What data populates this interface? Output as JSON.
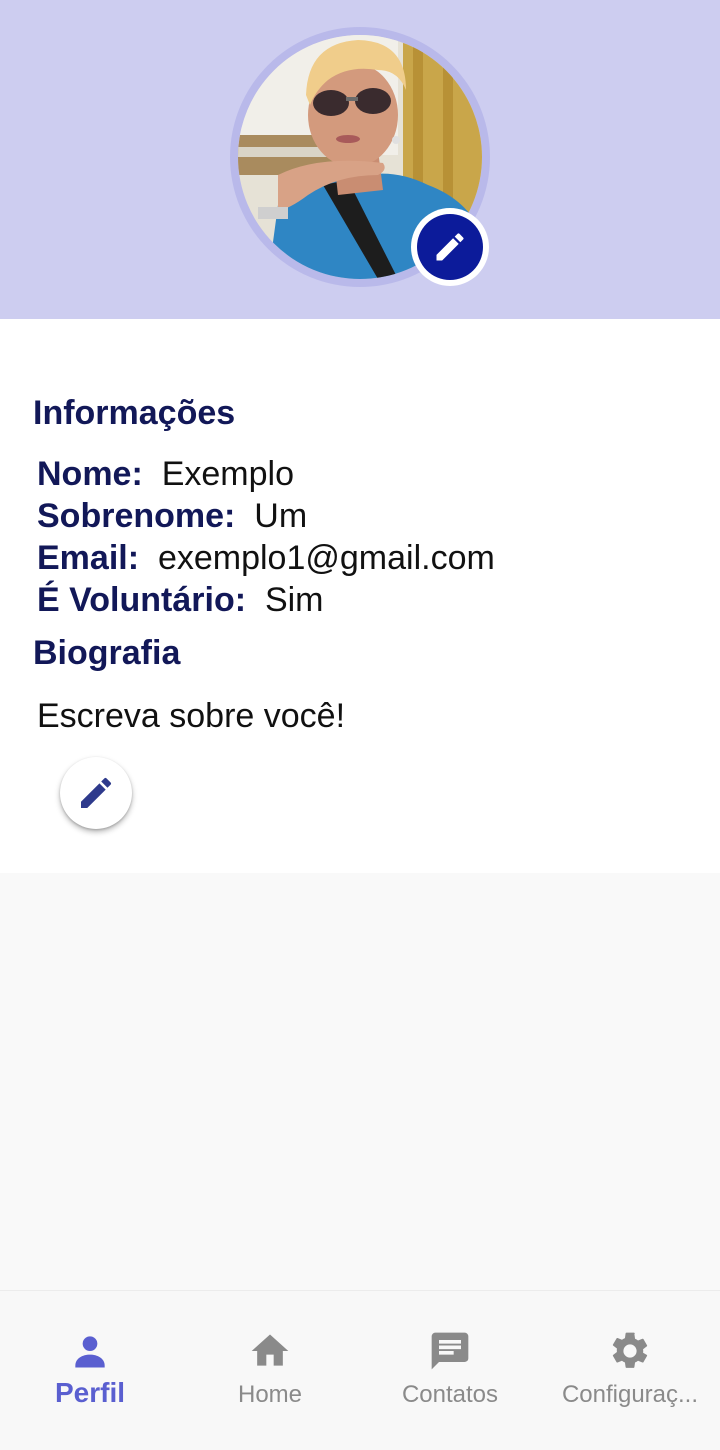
{
  "header": {
    "avatar_alt": "Foto de perfil",
    "colors": {
      "background": "#cdcdf0",
      "edit_button": "#0c1b9a"
    },
    "edit_icon": "pencil-icon"
  },
  "info": {
    "title": "Informações",
    "fields": [
      {
        "label": "Nome:",
        "value": "Exemplo"
      },
      {
        "label": "Sobrenome:",
        "value": "Um"
      },
      {
        "label": "Email:",
        "value": "exemplo1@gmail.com"
      },
      {
        "label": "É Voluntário:",
        "value": "Sim"
      }
    ]
  },
  "bio": {
    "title": "Biografia",
    "text": "Escreva sobre você!",
    "edit_icon": "pencil-icon"
  },
  "bottom_nav": {
    "items": [
      {
        "label": "Perfil",
        "icon": "person-icon",
        "active": true
      },
      {
        "label": "Home",
        "icon": "home-icon",
        "active": false
      },
      {
        "label": "Contatos",
        "icon": "chat-icon",
        "active": false
      },
      {
        "label": "Configuraç...",
        "icon": "gear-icon",
        "active": false
      }
    ],
    "colors": {
      "active": "#5a5fd0",
      "inactive": "#8a8a8a"
    }
  }
}
